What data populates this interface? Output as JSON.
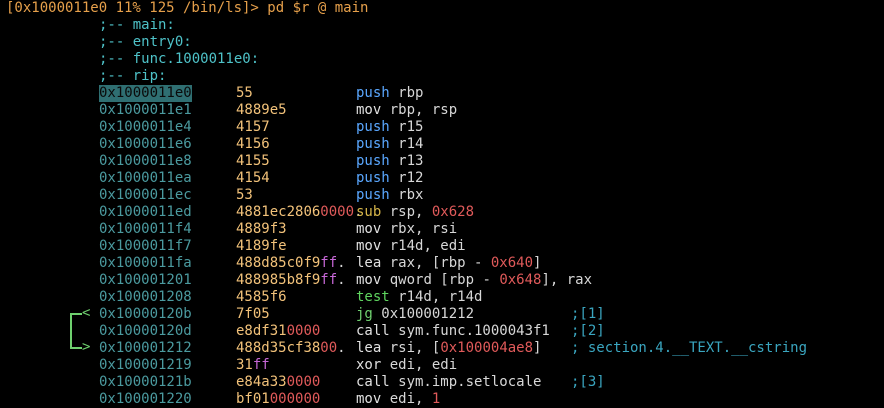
{
  "prompt": "[0x1000011e0 11% 125 /bin/ls]> pd $r @ main",
  "labels": [
    ";-- main:",
    ";-- entry0:",
    ";-- func.1000011e0:",
    ";-- rip:"
  ],
  "rows": [
    {
      "addr": "0x1000011e0",
      "bytes": "55",
      "asm": "push rbp",
      "comment": ""
    },
    {
      "addr": "0x1000011e1",
      "bytes": "4889e5",
      "asm": "mov rbp, rsp",
      "comment": ""
    },
    {
      "addr": "0x1000011e4",
      "bytes": "4157",
      "asm": "push r15",
      "comment": ""
    },
    {
      "addr": "0x1000011e6",
      "bytes": "4156",
      "asm": "push r14",
      "comment": ""
    },
    {
      "addr": "0x1000011e8",
      "bytes": "4155",
      "asm": "push r13",
      "comment": ""
    },
    {
      "addr": "0x1000011ea",
      "bytes": "4154",
      "asm": "push r12",
      "comment": ""
    },
    {
      "addr": "0x1000011ec",
      "bytes": "53",
      "asm": "push rbx",
      "comment": ""
    },
    {
      "addr": "0x1000011ed",
      "bytes": "4881ec28060000.",
      "asm": "sub rsp, 0x628",
      "comment": ""
    },
    {
      "addr": "0x1000011f4",
      "bytes": "4889f3",
      "asm": "mov rbx, rsi",
      "comment": ""
    },
    {
      "addr": "0x1000011f7",
      "bytes": "4189fe",
      "asm": "mov r14d, edi",
      "comment": ""
    },
    {
      "addr": "0x1000011fa",
      "bytes": "488d85c0f9ff.",
      "asm": "lea rax, [rbp - 0x640]",
      "comment": ""
    },
    {
      "addr": "0x100001201",
      "bytes": "488985b8f9ff.",
      "asm": "mov qword [rbp - 0x648], rax",
      "comment": ""
    },
    {
      "addr": "0x100001208",
      "bytes": "4585f6",
      "asm": "test r14d, r14d",
      "comment": ""
    },
    {
      "addr": "0x10000120b",
      "bytes": "7f05",
      "asm": "jg 0x100001212",
      "comment": ";[1]"
    },
    {
      "addr": "0x10000120d",
      "bytes": "e8df310000",
      "asm": "call sym.func.1000043f1",
      "comment": ";[2]"
    },
    {
      "addr": "0x100001212",
      "bytes": "488d35cf3800.",
      "asm": "lea rsi, [0x100004ae8]",
      "comment": "; section.4.__TEXT.__cstring"
    },
    {
      "addr": "0x100001219",
      "bytes": "31ff",
      "asm": "xor edi, edi",
      "comment": ""
    },
    {
      "addr": "0x10000121b",
      "bytes": "e84a330000",
      "asm": "call sym.imp.setlocale",
      "comment": ";[3]"
    },
    {
      "addr": "0x100001220",
      "bytes": "bf01000000",
      "asm": "mov edi, 1",
      "comment": ""
    }
  ],
  "jump_arrow": {
    "from_marker": "<",
    "to_marker": ">"
  },
  "colors": {
    "background": "#000000",
    "prompt": "#e6a04b",
    "label": "#4ec2c8",
    "address": "#4b9a9f",
    "current_address_bg": "#2f6f72",
    "push": "#5aa7ff",
    "sub": "#d7b64a",
    "test_jmp": "#6fd16f",
    "immediate": "#e05a5a",
    "comment": "#3aa6c0"
  }
}
